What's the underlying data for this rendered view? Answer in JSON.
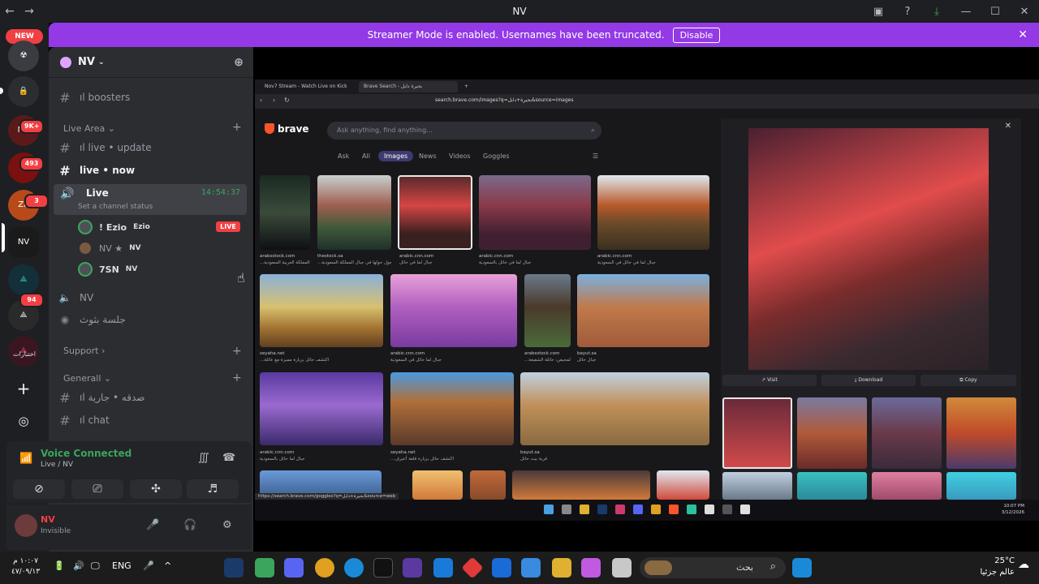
{
  "window": {
    "title": "NV"
  },
  "banner": {
    "text": "Streamer Mode is enabled. Usernames have been truncated.",
    "button": "Disable"
  },
  "rail": {
    "new_badge": "NEW",
    "badges": [
      "9K+",
      "493",
      "3",
      "94"
    ],
    "bottom_label": "اختبارات"
  },
  "guild": {
    "name": "NV"
  },
  "channels": {
    "boosters": "ıl boosters",
    "cat_live_area": "Live Area",
    "live_update": "ıl live • update",
    "live_now": "live • now",
    "voice_live": "Live",
    "voice_live_time": "14:54:37",
    "voice_live_status": "Set a channel status",
    "voice_users": [
      {
        "name": "! Ezio",
        "tag": "Ezio"
      },
      {
        "name": "NV ★",
        "tag": "NV"
      },
      {
        "name": "7SN",
        "tag": "NV"
      }
    ],
    "live_badge": "LIVE",
    "voice_nv": "NV",
    "voice_session": "جلسة بثوث",
    "cat_support": "Support",
    "cat_general": "Generall",
    "sadaqa": "ıl صدقه • جارية",
    "chat": "ıl chat"
  },
  "voice_panel": {
    "status": "Voice Connected",
    "channel": "Live / NV"
  },
  "user_panel": {
    "name": "NV",
    "status": "Invisible"
  },
  "browser": {
    "tabs": [
      "Nov7 Stream - Watch Live on Kick",
      "Brave Search - بحيرة دابل"
    ],
    "url": "search.brave.com/images?q=بحيرة+دابل&source=images",
    "logo": "brave",
    "search_placeholder": "Ask anything, find anything...",
    "filters": [
      "Ask",
      "All",
      "Images",
      "News",
      "Videos",
      "Goggles"
    ],
    "captions": [
      {
        "src": "arabsstock.com",
        "title": "...في المملكة العربية السعودية"
      },
      {
        "src": "thestock.sa",
        "title": "...تجول حولها في جبال المملكة السعودية"
      },
      {
        "src": "arabic.cnn.com",
        "title": "جبال لما في حائل"
      },
      {
        "src": "arabic.cnn.com",
        "title": "جبال لما في حائل بالسعودية"
      },
      {
        "src": "arabic.cnn.com",
        "title": "جبال لما في حائل في السعودية"
      },
      {
        "src": "seyaha.net",
        "title": "...اكتشف حائل بزيارة مميزة مع عائلة"
      },
      {
        "src": "arabic.cnn.com",
        "title": "جبال لما حائل في السعودية"
      },
      {
        "src": "arabsstock.com",
        "title": "...والمحيص: حائلة الشفيعة"
      },
      {
        "src": "bayut.sa",
        "title": "جبال حائل"
      },
      {
        "src": "arabic.cnn.com",
        "title": "جبال لما حائل بالسعودية"
      },
      {
        "src": "seyaha.net",
        "title": "...اكتشف حائل بزيارة قلعة أعيرف"
      },
      {
        "src": "bayut.sa",
        "title": "قرية بيت حائل"
      }
    ],
    "preview_buttons": [
      "Visit",
      "Download",
      "Copy"
    ],
    "status_url": "https://search.brave.com/goggles?q=بحيرة+دابل&source=web",
    "inner_clock": {
      "time": "10:07 PM",
      "date": "3/12/2026"
    }
  },
  "taskbar": {
    "clock_time": "١٠:٠٧ م",
    "clock_date": "٤٧/٠٩/١٣",
    "lang": "ENG",
    "search_placeholder": "بحث",
    "weather_temp": "25°C",
    "weather_text": "عالم جزئيا"
  },
  "colors": {
    "banner": "#9339e6",
    "discord_green": "#3ba55d",
    "discord_red": "#f23f43",
    "brave_orange": "#fb542b"
  }
}
